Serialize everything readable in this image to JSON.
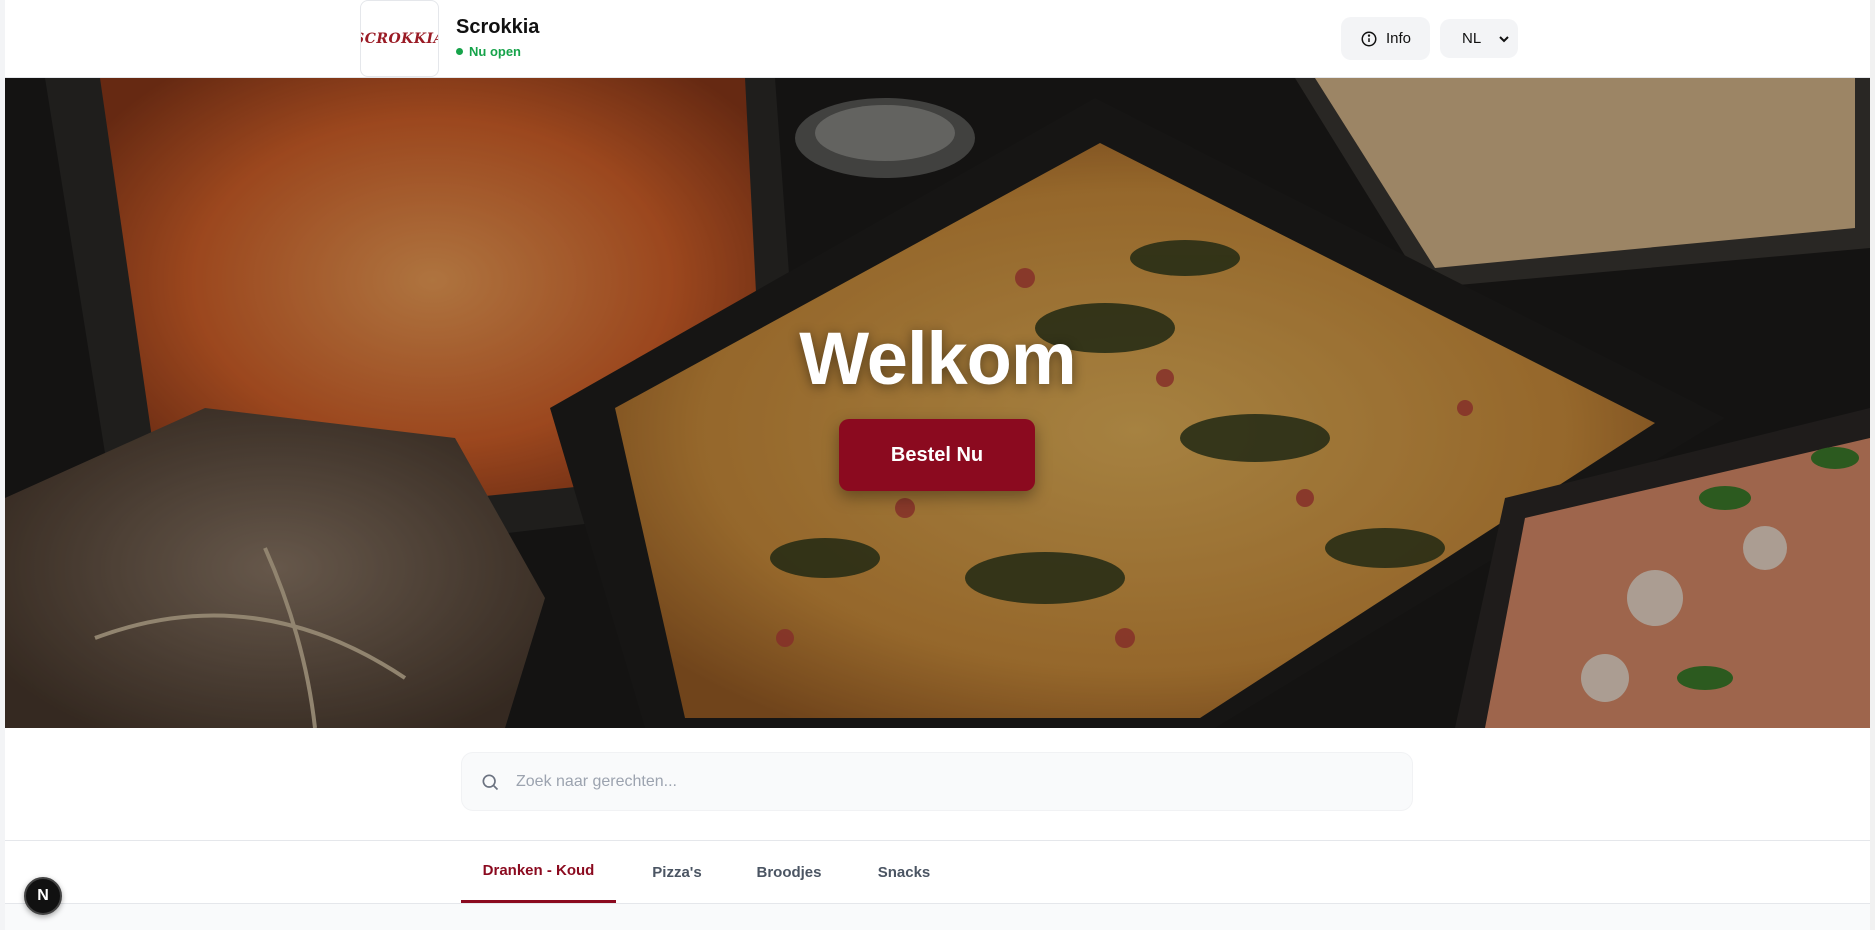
{
  "header": {
    "logo_text": "SCROKKIA",
    "brand_name": "Scrokkia",
    "status_text": "Nu open",
    "info_label": "Info",
    "language_selected": "NL"
  },
  "hero": {
    "title": "Welkom",
    "order_button": "Bestel Nu"
  },
  "search": {
    "placeholder": "Zoek naar gerechten...",
    "value": ""
  },
  "tabs": [
    {
      "label": "Dranken - Koud",
      "active": true
    },
    {
      "label": "Pizza's",
      "active": false
    },
    {
      "label": "Broodjes",
      "active": false
    },
    {
      "label": "Snacks",
      "active": false
    }
  ],
  "floating_badge": {
    "letter": "N"
  },
  "colors": {
    "brand": "#8b0a1f",
    "status_open": "#16a34a",
    "muted_bg": "#f3f4f6"
  },
  "icons": {
    "info": "info-circle-icon",
    "chevron": "chevron-down-icon",
    "search": "search-icon"
  }
}
